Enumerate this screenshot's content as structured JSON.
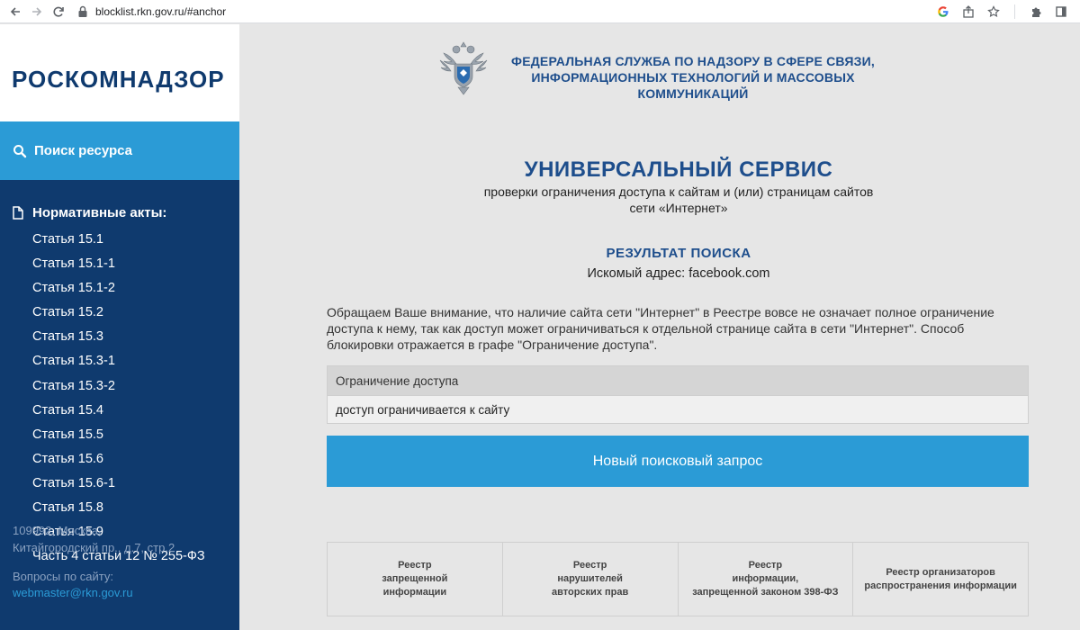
{
  "browser": {
    "url": "blocklist.rkn.gov.ru/#anchor"
  },
  "sidebar": {
    "logo": "РОСКОМНАДЗОР",
    "search_button": "Поиск ресурса",
    "norm_heading": "Нормативные акты:",
    "norm_items": [
      "Статья 15.1",
      "Статья 15.1-1",
      "Статья 15.1-2",
      "Статья 15.2",
      "Статья 15.3",
      "Статья 15.3-1",
      "Статья 15.3-2",
      "Статья 15.4",
      "Статья 15.5",
      "Статья 15.6",
      "Статья 15.6-1",
      "Статья 15.8",
      "Статья 15.9",
      "Часть 4 статьи 12 № 255-ФЗ"
    ],
    "address_line1": "109992, Москва,",
    "address_line2": "Китайгородский пр., д.7, стр.2",
    "questions": "Вопросы по сайту:",
    "email": "webmaster@rkn.gov.ru"
  },
  "header": {
    "agency": "ФЕДЕРАЛЬНАЯ СЛУЖБА ПО НАДЗОРУ В СФЕРЕ СВЯЗИ, ИНФОРМАЦИОННЫХ ТЕХНОЛОГИЙ И МАССОВЫХ КОММУНИКАЦИЙ"
  },
  "service": {
    "title": "УНИВЕРСАЛЬНЫЙ СЕРВИС",
    "subtitle_line1": "проверки ограничения доступа к сайтам и (или) страницам сайтов",
    "subtitle_line2": "сети «Интернет»"
  },
  "result": {
    "title": "РЕЗУЛЬТАТ ПОИСКА",
    "address": "Искомый адрес: facebook.com",
    "notice": "Обращаем Ваше внимание, что наличие сайта сети \"Интернет\" в Реестре вовсе не означает полное ограничение доступа к нему, так как доступ может ограничиваться к отдельной странице сайта в сети \"Интернет\". Способ блокировки отражается в графе \"Ограничение доступа\".",
    "table_header": "Ограничение доступа",
    "table_value": "доступ ограничивается к сайту",
    "new_search": "Новый поисковый запрос"
  },
  "registries": [
    "Реестр\nзапрещенной\nинформации",
    "Реестр\nнарушителей\nавторских прав",
    "Реестр\nинформации,\nзапрещенной законом 398-ФЗ",
    "Реестр организаторов\nраспространения информации"
  ],
  "colors": {
    "sidebar_bg": "#0f3a6e",
    "accent_blue": "#2b9bd6",
    "title_blue": "#1e4e8c",
    "page_bg": "#e6e6e6"
  }
}
